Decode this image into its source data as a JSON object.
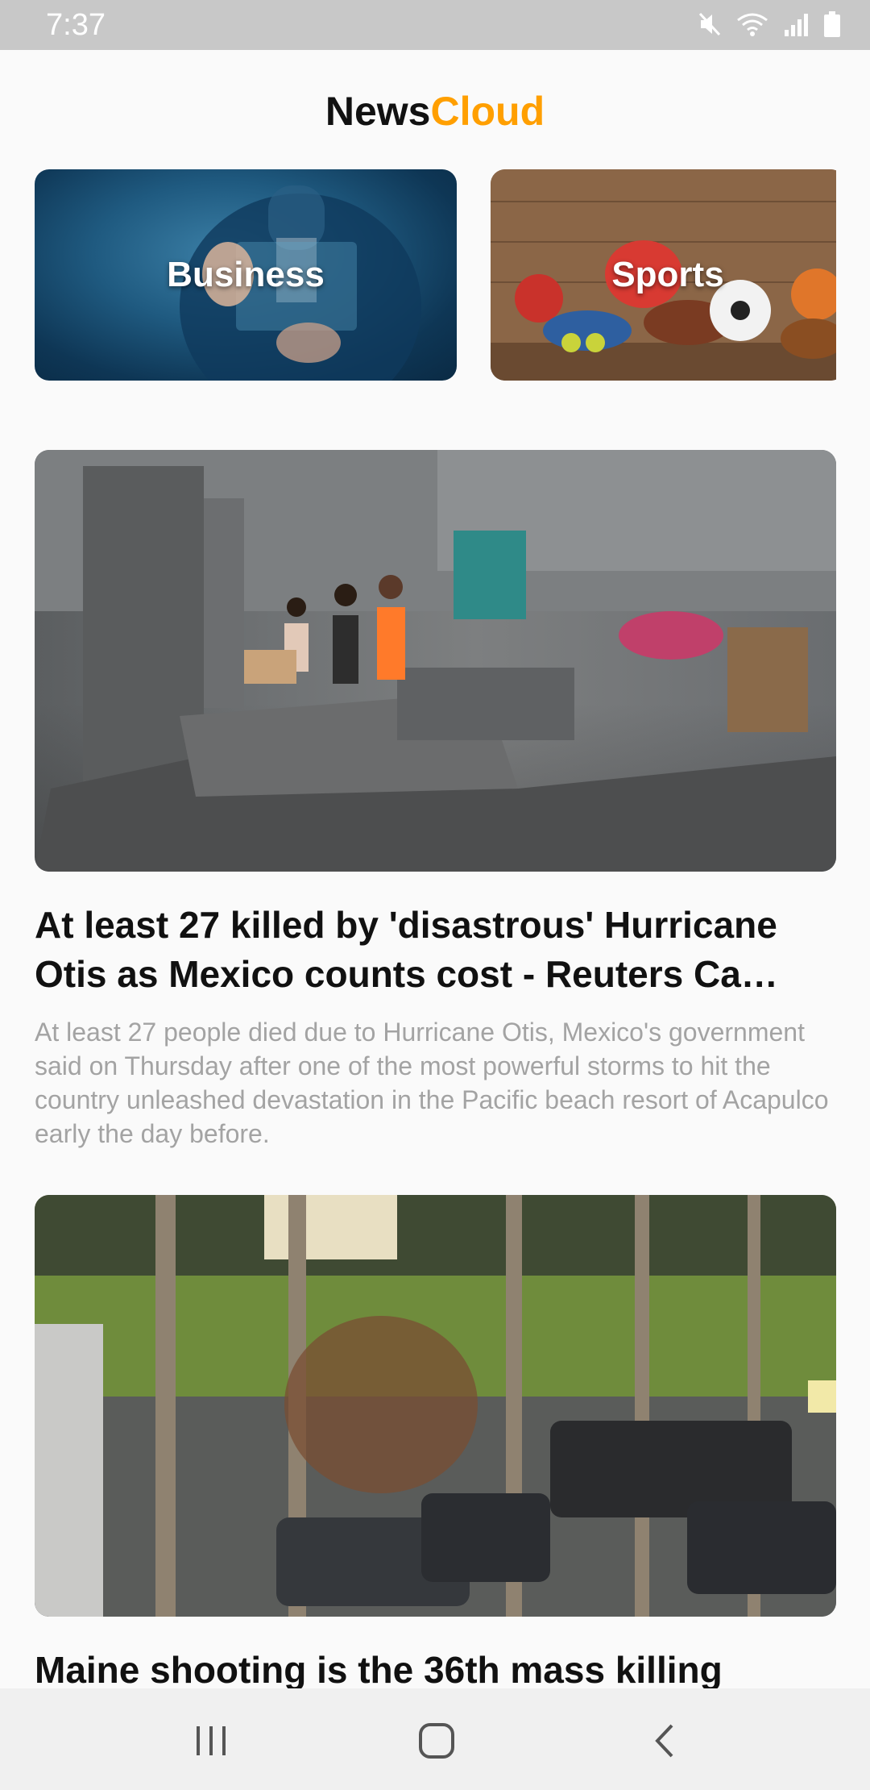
{
  "status_bar": {
    "time": "7:37",
    "icons": [
      "mute-icon",
      "wifi-icon",
      "signal-icon",
      "battery-icon"
    ]
  },
  "app": {
    "title_part1": "News",
    "title_part2": "Cloud",
    "accent_color": "#ff9f00"
  },
  "categories": [
    {
      "label": "Business"
    },
    {
      "label": "Sports"
    }
  ],
  "articles": [
    {
      "title": "At least 27 killed by 'disastrous' Hurricane Otis as Mexico counts cost - Reuters Ca…",
      "description": "At least 27 people died due to Hurricane Otis, Mexico's government said on Thursday after one of the most powerful storms to hit the country unleashed devastation in the Pacific beach resort of Acapulco early the day before."
    },
    {
      "title": "Maine shooting is the 36th mass killing",
      "description": ""
    }
  ],
  "nav": {
    "icons": [
      "recent-apps-icon",
      "home-icon",
      "back-icon"
    ]
  }
}
